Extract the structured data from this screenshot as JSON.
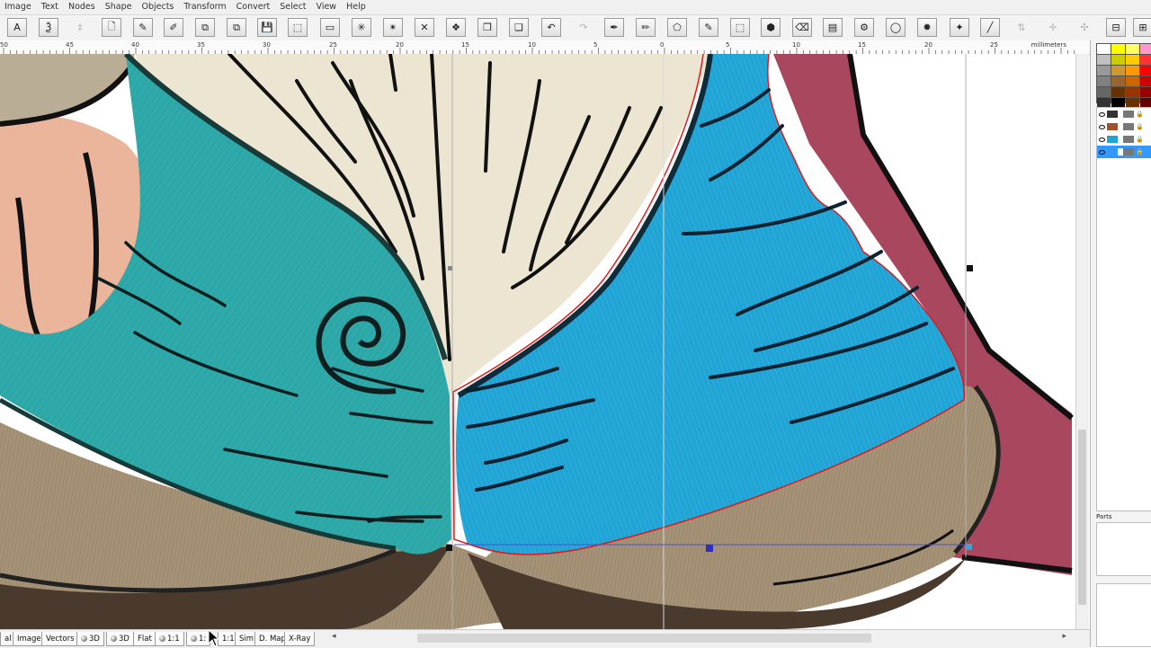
{
  "menu": [
    "Image",
    "Text",
    "Nodes",
    "Shape",
    "Objects",
    "Transform",
    "Convert",
    "Select",
    "View",
    "Help"
  ],
  "toolbar": {
    "buttons": [
      {
        "name": "text-tool-button",
        "glyph": "A"
      },
      {
        "name": "multi-text-tool-button",
        "glyph": "Ѯ"
      },
      {
        "name": "text-options-button",
        "glyph": "‡"
      },
      {
        "name": "new-file-button",
        "glyph": "🗋"
      },
      {
        "name": "open-file-button",
        "glyph": "✎"
      },
      {
        "name": "edit-file-button",
        "glyph": "✐"
      },
      {
        "name": "import-button",
        "glyph": "⧉"
      },
      {
        "name": "import-all-button",
        "glyph": "⧉"
      },
      {
        "name": "save-button",
        "glyph": "💾"
      },
      {
        "name": "select-frame-button",
        "glyph": "⬚"
      },
      {
        "name": "rectangle-tool-button",
        "glyph": "▭"
      },
      {
        "name": "select-nodes-button",
        "glyph": "✳"
      },
      {
        "name": "transform-nodes-button",
        "glyph": "✴"
      },
      {
        "name": "delete-button",
        "glyph": "✕"
      },
      {
        "name": "group-button",
        "glyph": "❖"
      },
      {
        "name": "copy-button",
        "glyph": "❐"
      },
      {
        "name": "paste-button",
        "glyph": "❏"
      },
      {
        "name": "undo-button",
        "glyph": "↶"
      },
      {
        "name": "redo-button",
        "glyph": "↷"
      },
      {
        "name": "pen-tool-button",
        "glyph": "✒"
      },
      {
        "name": "draw-tool-button",
        "glyph": "✏"
      },
      {
        "name": "shape-tool-button",
        "glyph": "⬠"
      },
      {
        "name": "eyedropper-button",
        "glyph": "✎"
      },
      {
        "name": "fill-tool-button",
        "glyph": "⬚"
      },
      {
        "name": "stitch-fill-button",
        "glyph": "⬢"
      },
      {
        "name": "eraser-button",
        "glyph": "⌫"
      },
      {
        "name": "satin-button",
        "glyph": "▤"
      },
      {
        "name": "settings-button",
        "glyph": "⚙"
      },
      {
        "name": "outline-button",
        "glyph": "◯"
      },
      {
        "name": "color-tool-button",
        "glyph": "✹"
      },
      {
        "name": "magic-wand-button",
        "glyph": "✦"
      },
      {
        "name": "line-tool-button",
        "glyph": "╱"
      },
      {
        "name": "align-button",
        "glyph": "⇅"
      },
      {
        "name": "distribute-button",
        "glyph": "✛"
      },
      {
        "name": "pan-button",
        "glyph": "✣"
      },
      {
        "name": "window-button",
        "glyph": "⊟"
      },
      {
        "name": "close-panel-button",
        "glyph": "⊞"
      }
    ]
  },
  "ruler": {
    "labels": [
      "50",
      "45",
      "40",
      "35",
      "30",
      "25",
      "20",
      "15",
      "10",
      "5",
      "0",
      "5",
      "10",
      "15",
      "20",
      "25"
    ],
    "units": "millimeters"
  },
  "view_tabs": [
    {
      "label": "al",
      "dot": false
    },
    {
      "label": "Image",
      "dot": false
    },
    {
      "label": "Vectors",
      "dot": false
    },
    {
      "label": "3D",
      "dot": true
    },
    {
      "label": "3D",
      "dot": true
    },
    {
      "label": "Flat",
      "dot": false
    },
    {
      "label": "1:1",
      "dot": true
    },
    {
      "label": "1:",
      "dot": true
    },
    {
      "label": "1:1",
      "dot": false
    },
    {
      "label": "Sim",
      "dot": false
    },
    {
      "label": "D. Map",
      "dot": false
    },
    {
      "label": "X-Ray",
      "dot": false
    }
  ],
  "palette": [
    "#ffffff",
    "#ffff00",
    "#ffff66",
    "#ff99cc",
    "#c0c0c0",
    "#cccc00",
    "#ffcc00",
    "#ff3333",
    "#999999",
    "#cc9933",
    "#ff9900",
    "#ff0000",
    "#808080",
    "#996633",
    "#cc6600",
    "#cc0000",
    "#666666",
    "#663300",
    "#993300",
    "#990000",
    "#333333",
    "#000000",
    "#663300",
    "#660000"
  ],
  "layers": [
    {
      "name": "layer-1",
      "selected": false
    },
    {
      "name": "layer-2",
      "selected": false
    },
    {
      "name": "layer-3",
      "selected": false
    },
    {
      "name": "layer-4",
      "selected": true
    }
  ],
  "panels": {
    "parts_label": "Parts"
  }
}
